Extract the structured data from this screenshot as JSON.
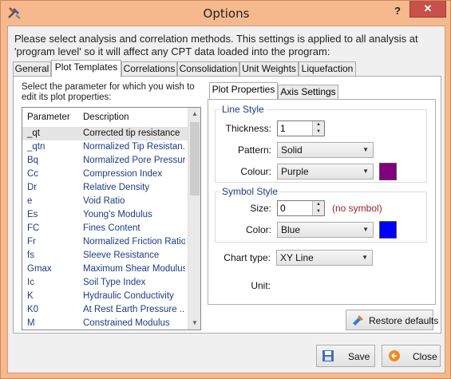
{
  "window": {
    "title": "Options",
    "help_label": "?",
    "close_label": "✕"
  },
  "intro_text": "Please select analysis and correlation methods. This settings is applied to all analysis at 'program level' so it will affect any CPT data loaded into the program:",
  "tabs": [
    "General",
    "Plot Templates",
    "Correlations",
    "Consolidation",
    "Unit Weights",
    "Liquefaction"
  ],
  "active_tab": "Plot Templates",
  "list_hint": "Select the parameter for which you wish to edit its plot properties:",
  "list": {
    "headers": {
      "parameter": "Parameter",
      "description": "Description"
    },
    "rows": [
      {
        "p": "_qt",
        "d": "Corrected tip resistance"
      },
      {
        "p": "_qtn",
        "d": "Normalized Tip Resistan..."
      },
      {
        "p": "Bq",
        "d": "Normalized Pore Pressure"
      },
      {
        "p": "Cc",
        "d": "Compression Index"
      },
      {
        "p": "Dr",
        "d": "Relative Density"
      },
      {
        "p": "e",
        "d": "Void Ratio"
      },
      {
        "p": "Es",
        "d": "Young's Modulus"
      },
      {
        "p": "FC",
        "d": "Fines Content"
      },
      {
        "p": "Fr",
        "d": "Normalized Friction Ratio"
      },
      {
        "p": "fs",
        "d": "Sleeve Resistance"
      },
      {
        "p": "Gmax",
        "d": "Maximum Shear Modulus"
      },
      {
        "p": "Ic",
        "d": "Soil Type Index"
      },
      {
        "p": "K",
        "d": "Hydraulic Conductivity"
      },
      {
        "p": "K0",
        "d": "At Rest Earth Pressure ..."
      },
      {
        "p": "M",
        "d": "Constrained Modulus"
      }
    ],
    "selected_index": 0,
    "scroll_fraction": 0.0
  },
  "inner_tabs": [
    "Plot Properties",
    "Axis Settings"
  ],
  "active_inner_tab": "Plot Properties",
  "line_style": {
    "title": "Line Style",
    "thickness_label": "Thickness:",
    "thickness_value": "1",
    "pattern_label": "Pattern:",
    "pattern_value": "Solid",
    "colour_label": "Colour:",
    "colour_value": "Purple",
    "colour_hex": "#800080"
  },
  "symbol_style": {
    "title": "Symbol Style",
    "size_label": "Size:",
    "size_value": "0",
    "size_note": "(no symbol)",
    "color_label": "Color:",
    "color_value": "Blue",
    "color_hex": "#0000ff"
  },
  "chart_type_label": "Chart type:",
  "chart_type_value": "XY Line",
  "unit_label": "Unit:",
  "buttons": {
    "restore": "Restore defaults",
    "save": "Save",
    "close": "Close"
  }
}
